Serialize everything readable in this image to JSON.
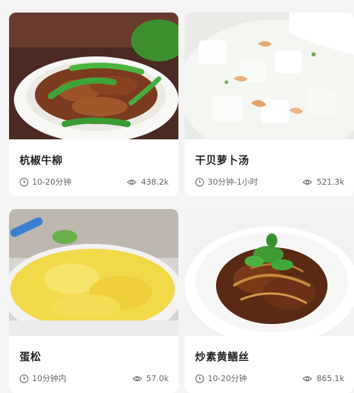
{
  "recipes": [
    {
      "title": "杭椒牛柳",
      "time": "10-20分钟",
      "views": "438.2k"
    },
    {
      "title": "干贝萝卜汤",
      "time": "30分钟-1小时",
      "views": "521.3k"
    },
    {
      "title": "蛋松",
      "time": "10分钟内",
      "views": "57.0k"
    },
    {
      "title": "炒素黄鳝丝",
      "time": "10-20分钟",
      "views": "865.1k"
    }
  ],
  "icons": {
    "time": "clock-icon",
    "views": "eye-icon"
  },
  "colors": {
    "background": "#f4f4f4",
    "card": "#ffffff",
    "title": "#222222",
    "meta": "#666666"
  }
}
